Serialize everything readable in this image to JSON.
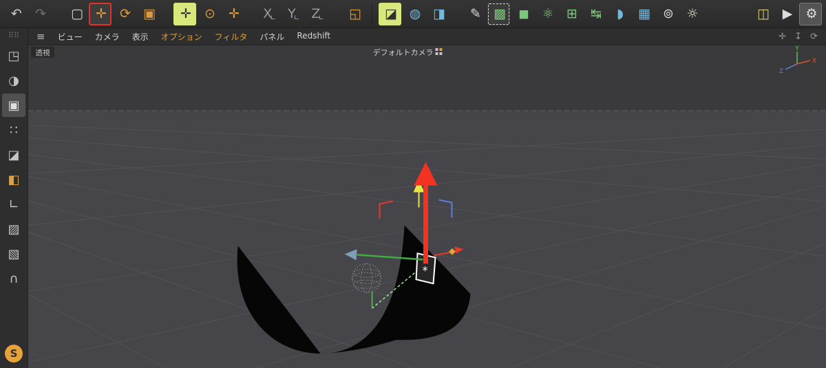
{
  "toolbar": {
    "history": [
      {
        "name": "undo-button",
        "glyph": "↶",
        "fg": "#c9c9c9"
      },
      {
        "name": "redo-button",
        "glyph": "↷",
        "fg": "#6e6e6e"
      }
    ],
    "transform": [
      {
        "name": "live-selection-button",
        "glyph": "▢",
        "fg": "#d6d6d6"
      },
      {
        "name": "move-button",
        "glyph": "✛",
        "fg": "#e09a3a",
        "cls": "sel-red"
      },
      {
        "name": "rotate-button",
        "glyph": "⟳",
        "fg": "#e09a3a"
      },
      {
        "name": "scale-button",
        "glyph": "▣",
        "fg": "#e09a3a"
      }
    ],
    "axis": [
      {
        "name": "enable-axis-button",
        "glyph": "✛",
        "fg": "#2f2f2f",
        "cls": "hl"
      },
      {
        "name": "gizmo-rotate-button",
        "glyph": "⊙",
        "fg": "#e09a3a"
      },
      {
        "name": "gizmo-move-button",
        "glyph": "✛",
        "fg": "#e09a3a"
      }
    ],
    "locks": [
      {
        "name": "lock-x-axis-button",
        "glyph": "X",
        "sub": "∟",
        "fg": "#9b9b9b"
      },
      {
        "name": "lock-y-axis-button",
        "glyph": "Y",
        "sub": "∟",
        "fg": "#9b9b9b"
      },
      {
        "name": "lock-z-axis-button",
        "glyph": "Z",
        "sub": "∟",
        "fg": "#9b9b9b"
      }
    ],
    "coords": [
      {
        "name": "coordinate-system-button",
        "glyph": "◱",
        "fg": "#e09a3a"
      }
    ],
    "render": [
      {
        "name": "render-view-button",
        "glyph": "◪",
        "fg": "#2f2f2f",
        "cls": "hl"
      },
      {
        "name": "render-picture-viewer-button",
        "glyph": "◍",
        "fg": "#74b8dc"
      },
      {
        "name": "render-settings-button",
        "glyph": "◨",
        "fg": "#74b8dc"
      }
    ],
    "create": [
      {
        "name": "spline-pen-button",
        "glyph": "✎",
        "fg": "#d8d8d8"
      },
      {
        "name": "subdivision-surface-button",
        "glyph": "▩",
        "fg": "#7dc67d",
        "cls": "sel-dash"
      },
      {
        "name": "primitive-cube-button",
        "glyph": "◼",
        "fg": "#7dc67d"
      },
      {
        "name": "volume-builder-button",
        "glyph": "⚛",
        "fg": "#7dc67d"
      },
      {
        "name": "cloner-button",
        "glyph": "⊞",
        "fg": "#7dc67d"
      },
      {
        "name": "connector-button",
        "glyph": "↹",
        "fg": "#7dc67d"
      },
      {
        "name": "metaball-button",
        "glyph": "◗",
        "fg": "#74b8dc"
      },
      {
        "name": "array-button",
        "glyph": "▦",
        "fg": "#74b8dc"
      },
      {
        "name": "camera-button",
        "glyph": "⊚",
        "fg": "#cfd3d6"
      },
      {
        "name": "light-button",
        "glyph": "☼",
        "fg": "#e6e6c8"
      }
    ],
    "right": [
      {
        "name": "takes-button",
        "glyph": "◫",
        "fg": "#d8c874"
      },
      {
        "name": "play-render-button",
        "glyph": "▶",
        "fg": "#dddddd"
      },
      {
        "name": "settings-button",
        "glyph": "⚙",
        "fg": "#dddddd",
        "cls": "boxed"
      }
    ]
  },
  "menubar": {
    "hamburger": "≡",
    "items": [
      {
        "label": "ビュー",
        "fg": "#d6d6d6"
      },
      {
        "label": "カメラ",
        "fg": "#d6d6d6"
      },
      {
        "label": "表示",
        "fg": "#d6d6d6"
      },
      {
        "label": "オプション",
        "fg": "#e0a23a"
      },
      {
        "label": "フィルタ",
        "fg": "#e0a23a"
      },
      {
        "label": "パネル",
        "fg": "#d6d6d6"
      },
      {
        "label": "Redshift",
        "fg": "#d6d6d6"
      }
    ],
    "right_icons": [
      {
        "name": "viewport-pan-icon",
        "glyph": "✛"
      },
      {
        "name": "viewport-dock-icon",
        "glyph": "↧"
      },
      {
        "name": "viewport-refresh-icon",
        "glyph": "⟳"
      }
    ]
  },
  "sidebar": {
    "grip": "⠿⠿",
    "items": [
      {
        "name": "make-editable-button",
        "glyph": "◳",
        "fg": "#c4c4c4"
      },
      {
        "name": "texture-mode-button",
        "glyph": "◑",
        "fg": "#c4c4c4"
      },
      {
        "name": "model-mode-button",
        "glyph": "▣",
        "fg": "#dcdcdc",
        "cls": "sel"
      },
      {
        "name": "point-mode-button",
        "glyph": "∷",
        "fg": "#c4c4c4"
      },
      {
        "name": "edge-mode-button",
        "glyph": "◪",
        "fg": "#c4c4c4"
      },
      {
        "name": "polygon-mode-button",
        "glyph": "◧",
        "fg": "#e0a23a"
      },
      {
        "name": "enable-axis-mode-button",
        "glyph": "∟",
        "fg": "#c4c4c4"
      },
      {
        "name": "workplane-mode-button",
        "glyph": "▨",
        "fg": "#c4c4c4"
      },
      {
        "name": "lock-workplane-button",
        "glyph": "▧",
        "fg": "#c4c4c4"
      },
      {
        "name": "snap-magnet-button",
        "glyph": "∩",
        "fg": "#c4c4c4"
      },
      {
        "name": "snap-badge",
        "glyph": "S",
        "fg": "#2f2f2f",
        "cls": "badge"
      }
    ]
  },
  "viewport": {
    "view_label": "透視",
    "camera_label": "デフォルトカメラ",
    "light_marker": "*",
    "axis_labels": {
      "x": "X",
      "y": "Y",
      "z": "Z"
    }
  },
  "colors": {
    "toolbar_bg": "#2d2d2d",
    "viewport_sky": "#3a3a3d",
    "viewport_ground": "#46464a",
    "grid_line": "#515156",
    "selection_red": "#e83022",
    "highlight_yellow": "#d9e87c",
    "axis_x": "#e8562a",
    "axis_y": "#58c358",
    "axis_z": "#5c7fd6",
    "gizmo_arrow_red": "#f23322",
    "gizmo_arrow_yellow": "#e8e44a",
    "gizmo_arrow_green": "#3fae3f"
  }
}
